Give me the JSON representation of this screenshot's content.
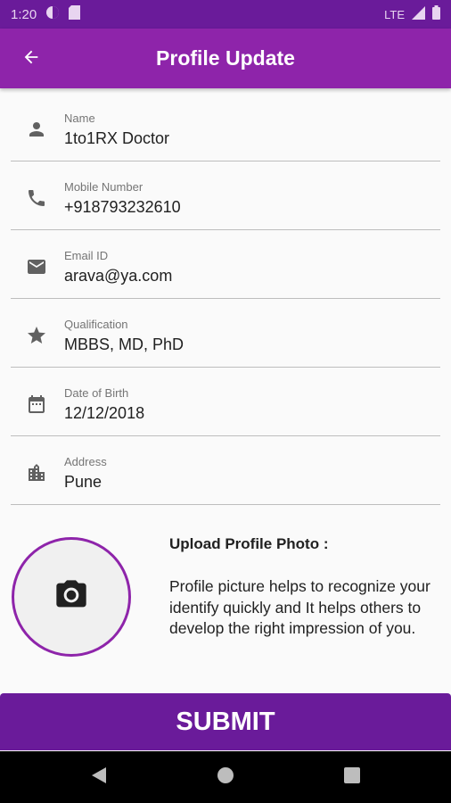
{
  "status_bar": {
    "time": "1:20",
    "network": "LTE"
  },
  "app_bar": {
    "title": "Profile Update",
    "back_icon": "arrow-left-icon"
  },
  "fields": [
    {
      "icon": "person-icon",
      "label": "Name",
      "value": "1to1RX Doctor"
    },
    {
      "icon": "phone-icon",
      "label": "Mobile Number",
      "value": "+918793232610"
    },
    {
      "icon": "email-icon",
      "label": "Email ID",
      "value": "arava@ya.com"
    },
    {
      "icon": "star-icon",
      "label": "Qualification",
      "value": "MBBS, MD, PhD"
    },
    {
      "icon": "calendar-icon",
      "label": "Date of Birth",
      "value": "12/12/2018"
    },
    {
      "icon": "building-icon",
      "label": "Address",
      "value": "Pune"
    }
  ],
  "upload": {
    "title": "Upload Profile Photo :",
    "description": "Profile picture helps to recognize your identify quickly and It helps others to develop the right impression of you.",
    "icon": "camera-icon"
  },
  "submit_label": "SUBMIT",
  "colors": {
    "status_bar": "#6a1b9a",
    "app_bar": "#8e24aa",
    "submit": "#6a1b9a",
    "accent": "#8e24aa"
  }
}
